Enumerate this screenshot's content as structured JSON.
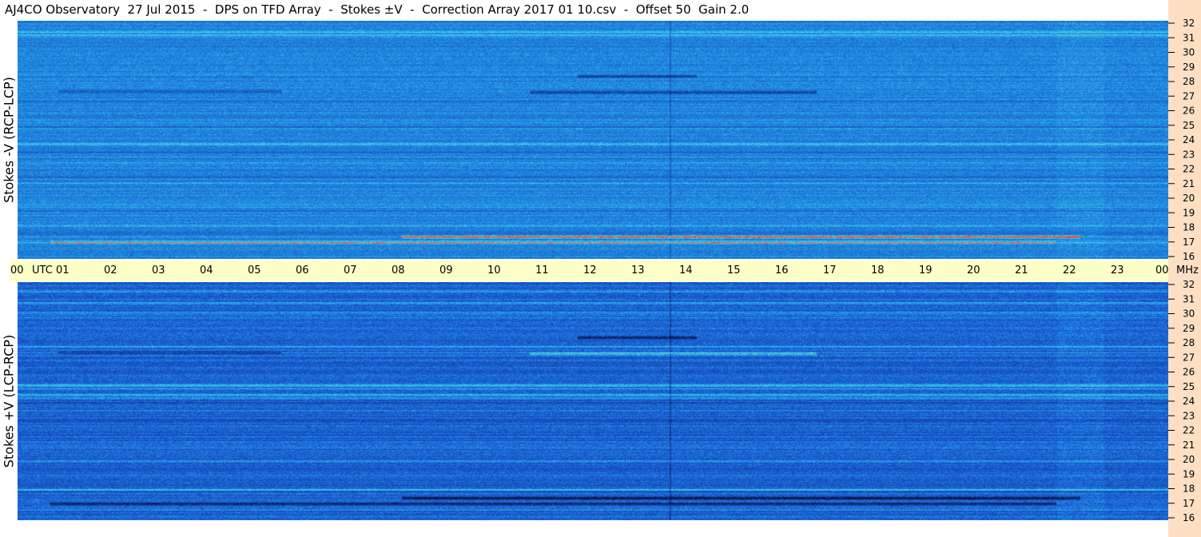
{
  "title": "AJ4CO Observatory  27 Jul 2015  -  DPS on TFD Array  -  Stokes ±V  -  Correction Array 2017 01 10.csv  -  Offset 50  Gain 2.0",
  "chart_data": [
    {
      "type": "heatmap",
      "ylabel": "Stokes -V (RCP-LCP)",
      "xlabel": "UTC",
      "ylim": [
        16,
        32
      ],
      "yticks": [
        "16",
        "17",
        "18",
        "19",
        "20",
        "21",
        "22",
        "23",
        "24",
        "25",
        "26",
        "27",
        "28",
        "29",
        "30",
        "31",
        "32"
      ],
      "xticks": [
        "00",
        "01",
        "02",
        "03",
        "04",
        "05",
        "06",
        "07",
        "08",
        "09",
        "10",
        "11",
        "12",
        "13",
        "14",
        "15",
        "16",
        "17",
        "18",
        "19",
        "20",
        "21",
        "22",
        "23",
        "00"
      ],
      "xlim": [
        0,
        24
      ],
      "colors": {
        "background": "#1e7fe0",
        "low": "#0a2a80",
        "high": "#ff3a20",
        "mid": "#40d8f0"
      }
    },
    {
      "type": "heatmap",
      "ylabel": "Stokes +V (LCP-RCP)",
      "xlabel": "UTC",
      "ylim": [
        16,
        32
      ],
      "yticks": [
        "16",
        "17",
        "18",
        "19",
        "20",
        "21",
        "22",
        "23",
        "24",
        "25",
        "26",
        "27",
        "28",
        "29",
        "30",
        "31",
        "32"
      ],
      "xticks": [
        "00",
        "01",
        "02",
        "03",
        "04",
        "05",
        "06",
        "07",
        "08",
        "09",
        "10",
        "11",
        "12",
        "13",
        "14",
        "15",
        "16",
        "17",
        "18",
        "19",
        "20",
        "21",
        "22",
        "23",
        "00"
      ],
      "xlim": [
        0,
        24
      ],
      "colors": {
        "background": "#1a5fd8",
        "low": "#050a30",
        "high": "#a0f070",
        "mid": "#30c0f0"
      }
    }
  ],
  "axis": {
    "utc_label": "UTC",
    "mhz_label": "MHz"
  },
  "colors": {
    "axis_band": "#ffffc8",
    "right_strip": "#fde0c4"
  }
}
